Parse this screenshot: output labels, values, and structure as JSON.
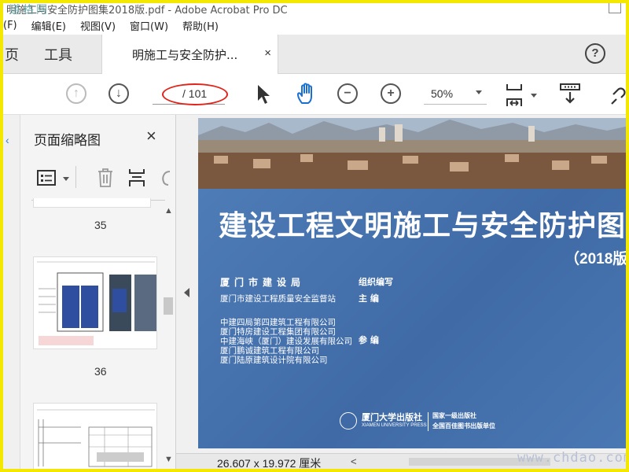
{
  "titlebar": {
    "title": "明施工与安全防护图集2018版.pdf - Adobe Acrobat Pro DC",
    "watermark": "道格网"
  },
  "menu": [
    "(F)",
    "编辑(E)",
    "视图(V)",
    "窗口(W)",
    "帮助(H)"
  ],
  "nav_tabs": {
    "home_label": "页",
    "tools_label": "工具"
  },
  "document_tab": {
    "label": "明施工与安全防护...",
    "close": "×"
  },
  "help_label": "?",
  "toolbar": {
    "page_count": "/ 101",
    "zoom_value": "50%"
  },
  "thumbnails": {
    "panel_title": "页面缩略图",
    "close": "×",
    "pages": [
      {
        "number": "35"
      },
      {
        "number": "36"
      }
    ]
  },
  "cover": {
    "title": "建设工程文明施工与安全防护图集",
    "year": "（2018版",
    "org_bold": "厦门市建设局",
    "org_role": "组织编写",
    "editor_org": "厦门市建设工程质量安全监督站",
    "editor_role": "主 编",
    "co_orgs": [
      "中建四局第四建筑工程有限公司",
      "厦门特房建设工程集团有限公司",
      "中建海峡（厦门）建设发展有限公司",
      "厦门鹏诚建筑工程有限公司",
      "厦门陆原建筑设计院有限公司"
    ],
    "co_role": "参 编",
    "publisher_name": "厦门大学出版社",
    "publisher_en": "XIAMEN UNIVERSITY PRESS",
    "publisher_note1": "国家一级出版社",
    "publisher_note2": "全国百佳图书出版单位"
  },
  "statusbar": {
    "dimensions": "26.607 x 19.972 厘米"
  },
  "watermark_bottom": "www.chdao.com"
}
